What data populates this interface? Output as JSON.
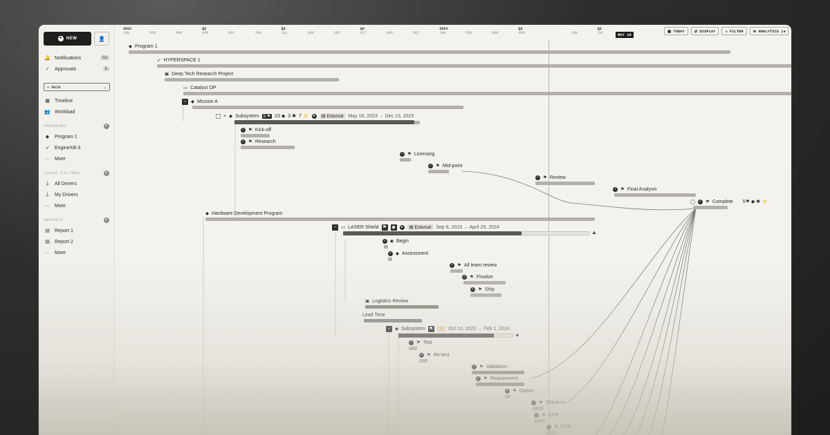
{
  "sidebar": {
    "new_label": "NEW",
    "notifications": {
      "label": "Notifications",
      "count": "52"
    },
    "approvals": {
      "label": "Approvals",
      "count": "5"
    },
    "branch": "MAIN",
    "timeline": "Timeline",
    "workload": "Workload",
    "programs_heading": "PROGRAMS",
    "programs": [
      "Program 1",
      "EngineXB-3",
      "More"
    ],
    "filters_heading": "SAVED FILTERS",
    "filters": [
      "All Drivers",
      "My Drivers",
      "More"
    ],
    "reports_heading": "REPORTS",
    "reports": [
      "Report 1",
      "Report 2",
      "More"
    ]
  },
  "header": {
    "ticks": [
      {
        "yr": "2023",
        "mo": "JAN"
      },
      {
        "yr": "",
        "mo": "FEB"
      },
      {
        "yr": "",
        "mo": "MAR"
      },
      {
        "yr": "Q2",
        "mo": "APR"
      },
      {
        "yr": "",
        "mo": "MAY"
      },
      {
        "yr": "",
        "mo": "JUN"
      },
      {
        "yr": "Q3",
        "mo": "JUL"
      },
      {
        "yr": "",
        "mo": "AUG"
      },
      {
        "yr": "",
        "mo": "SEP"
      },
      {
        "yr": "Q4",
        "mo": "OCT"
      },
      {
        "yr": "",
        "mo": "NOV"
      },
      {
        "yr": "",
        "mo": "DEC"
      },
      {
        "yr": "2024",
        "mo": "JAN"
      },
      {
        "yr": "",
        "mo": "FEB"
      },
      {
        "yr": "",
        "mo": "MAR"
      },
      {
        "yr": "Q2",
        "mo": "APR"
      },
      {
        "yr": "",
        "mo": ""
      },
      {
        "yr": "",
        "mo": "JUN"
      },
      {
        "yr": "Q3",
        "mo": "JUL"
      },
      {
        "yr": "",
        "mo": "AUG"
      }
    ],
    "today": "MAY 18",
    "buttons": [
      "TODAY",
      "DISPLAY",
      "FILTER",
      "ANALYTICS"
    ]
  },
  "rows": {
    "program1": "Program 1",
    "hyperspace": "HYPERSPACE 1",
    "deeptech": "Deep Tech Research Project",
    "catalyst": "Catalyst OP",
    "missiona": "Mission A",
    "subsystem1": {
      "label": "Subsystem",
      "flags": "5",
      "diamonds": "23",
      "stars": "3",
      "deps": "7",
      "external": "External",
      "dates": "May 18, 2023 → Dec 13, 2023"
    },
    "kickoff": "Kick-off",
    "research": "Research",
    "licensing": "Licensing",
    "midpoint": "Mid-point",
    "review": "Review",
    "finalanalysis": "Final Analysis",
    "complete": {
      "label": "Complete",
      "flags": "5"
    },
    "hardware": "Hardware Development Program",
    "laser": {
      "label": "LASER Shield",
      "external": "External",
      "dates": "Sep 8, 2023 → April 25, 2024"
    },
    "begin": "Begin",
    "assessment": "Assessment",
    "allteam": "All team review",
    "finalize": "Finalize",
    "ship": "Ship",
    "logistics": "Logistics Review",
    "leadtime": "Lead Time",
    "subsystem2": {
      "label": "Subsystem",
      "dates": "Oct 10, 2023 → Feb 1, 2024"
    },
    "test": "Test",
    "retest": "Re-test",
    "validation": "Validation",
    "requirement": "Requirement",
    "option": "Option",
    "checkin": "Check-in",
    "cdr": "CDR",
    "pdr": "PDR"
  }
}
